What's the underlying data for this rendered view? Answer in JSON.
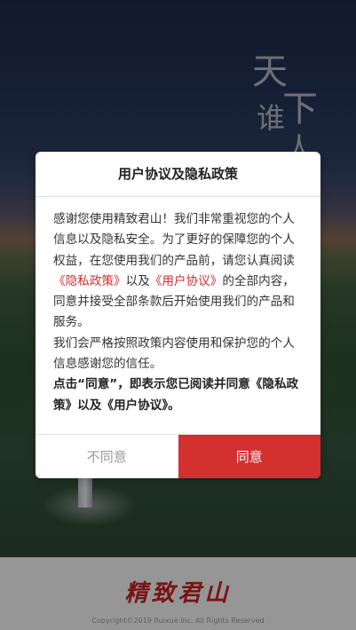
{
  "background": {
    "calligraphy": [
      "天",
      "下",
      "谁",
      "人"
    ]
  },
  "dialog": {
    "title": "用户协议及隐私政策",
    "para1_a": "感谢您使用精致君山！我们非常重视您的个人信息以及隐私安全。为了更好的保障您的个人权益，在您使用我们的产品前，请您认真阅读",
    "privacy_link": "《隐私政策》",
    "para1_b": "以及",
    "agreement_link": "《用户协议》",
    "para1_c": "的全部内容，同意并接受全部条款后开始使用我们的产品和服务。",
    "para2": "我们会严格按照政策内容使用和保护您的个人信息感谢您的信任。",
    "para3": "点击“同意”，即表示您已阅读并同意《隐私政策》以及《用户协议》。",
    "disagree_label": "不同意",
    "agree_label": "同意"
  },
  "footer": {
    "logo_text": "精致君山",
    "copyright": "Copyright©2019 Ruixue Inc. All Rights Reserved"
  },
  "colors": {
    "accent": "#d33030",
    "link": "#d12e2e"
  }
}
